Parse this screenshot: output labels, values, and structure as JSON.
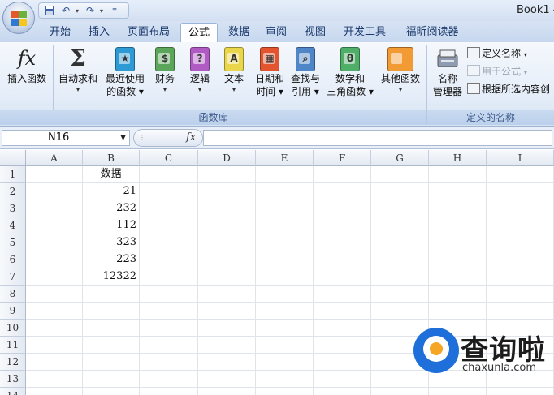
{
  "app": {
    "window_title": "Book1 -"
  },
  "quick_access": {
    "save_icon": "save-icon",
    "undo_icon": "undo-icon",
    "redo_icon": "redo-icon",
    "customize_icon": "customize-qat-icon"
  },
  "tabs": [
    {
      "label": "开始"
    },
    {
      "label": "插入"
    },
    {
      "label": "页面布局"
    },
    {
      "label": "公式"
    },
    {
      "label": "数据"
    },
    {
      "label": "审阅"
    },
    {
      "label": "视图"
    },
    {
      "label": "开发工具"
    },
    {
      "label": "福昕阅读器"
    }
  ],
  "active_tab": "公式",
  "ribbon": {
    "function_library": {
      "group_label": "函数库",
      "insert_function": "插入函数",
      "autosum": {
        "line1": "自动求和"
      },
      "recent": {
        "line1": "最近使用",
        "line2": "的函数"
      },
      "finance": {
        "line1": "财务"
      },
      "logic": {
        "line1": "逻辑"
      },
      "text": {
        "line1": "文本"
      },
      "datetime": {
        "line1": "日期和",
        "line2": "时间"
      },
      "lookup": {
        "line1": "查找与",
        "line2": "引用"
      },
      "math": {
        "line1": "数学和",
        "line2": "三角函数"
      },
      "other": {
        "line1": "其他函数"
      }
    },
    "defined_names": {
      "group_label": "定义的名称",
      "name_manager": {
        "line1": "名称",
        "line2": "管理器"
      },
      "define_name": "定义名称",
      "use_in_formula": "用于公式",
      "create_from_selection": "根据所选内容创"
    },
    "colors": {
      "recent": "#2e9ad4",
      "finance": "#5ba65a",
      "logic": "#b05bc4",
      "text": "#e9d64a",
      "datetime": "#e3552f",
      "lookup": "#4f86c8",
      "math": "#4fae67",
      "other": "#f29a33"
    }
  },
  "formula_bar": {
    "name_box": "N16",
    "fx_label": "fx",
    "formula": ""
  },
  "sheet": {
    "columns": [
      "A",
      "B",
      "C",
      "D",
      "E",
      "F",
      "G",
      "H",
      "I"
    ],
    "rows": [
      "1",
      "2",
      "3",
      "4",
      "5",
      "6",
      "7",
      "8",
      "9",
      "10",
      "11",
      "12",
      "13",
      "14"
    ],
    "cells": {
      "B1": "数据",
      "B2": "21",
      "B3": "232",
      "B4": "112",
      "B5": "323",
      "B6": "223",
      "B7": "12322"
    }
  },
  "watermark": {
    "title": "查询啦",
    "subtitle": "chaxunla.com",
    "brand_blue": "#1e6fd9",
    "brand_orange": "#f5a623"
  }
}
